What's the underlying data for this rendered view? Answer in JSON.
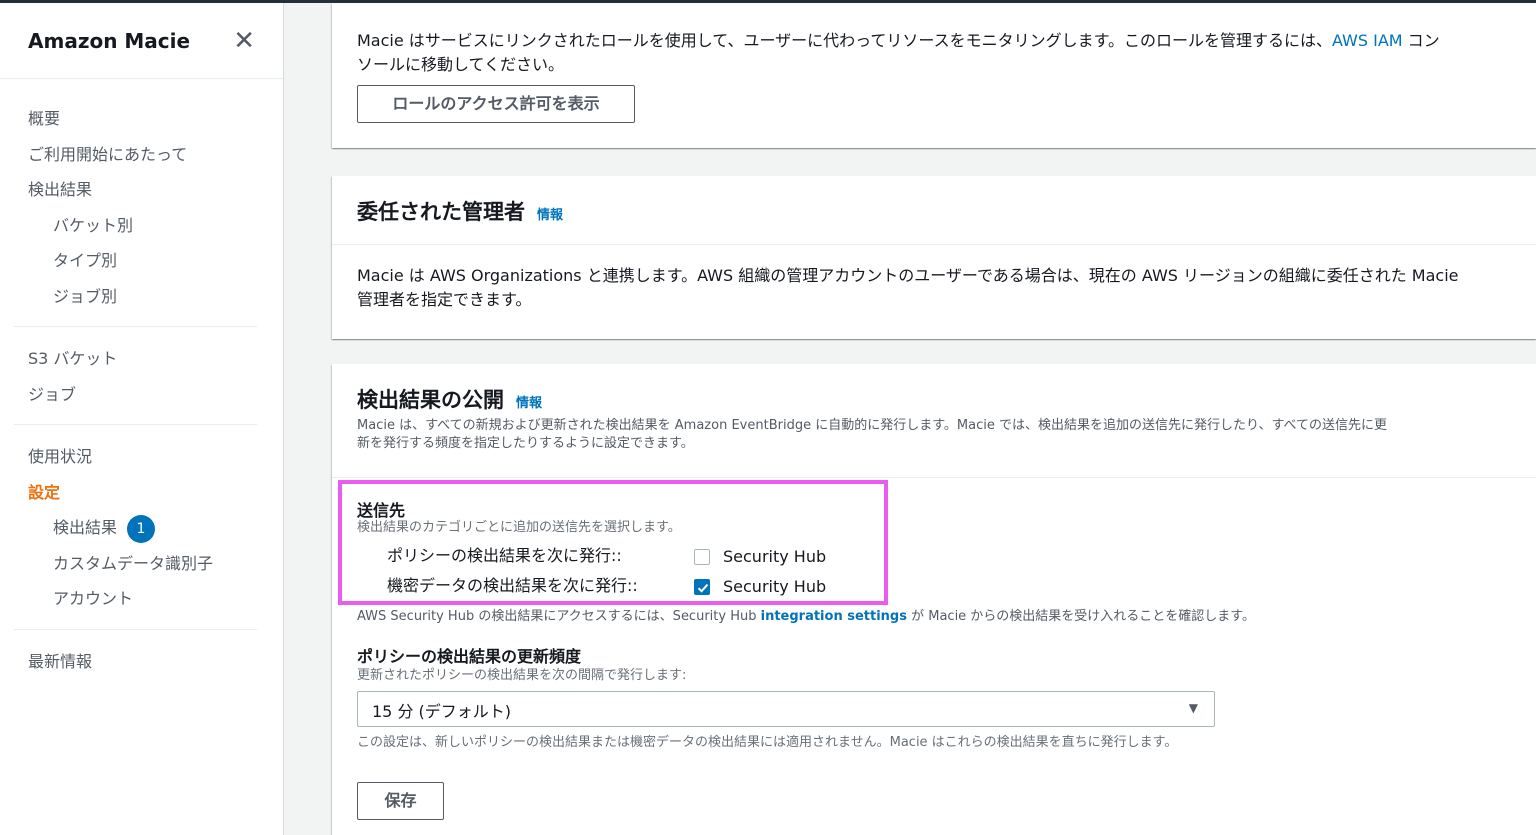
{
  "sidebar": {
    "title": "Amazon Macie",
    "items": [
      {
        "label": "概要"
      },
      {
        "label": "ご利用開始にあたって"
      },
      {
        "label": "検出結果"
      },
      {
        "label": "バケット別"
      },
      {
        "label": "タイプ別"
      },
      {
        "label": "ジョブ別"
      },
      {
        "label": "S3 バケット"
      },
      {
        "label": "ジョブ"
      },
      {
        "label": "使用状況"
      },
      {
        "label": "設定"
      },
      {
        "label": "検出結果",
        "badge": "1"
      },
      {
        "label": "カスタムデータ識別子"
      },
      {
        "label": "アカウント"
      },
      {
        "label": "最新情報"
      }
    ]
  },
  "role_panel": {
    "text_line1_pre": "Macie はサービスにリンクされたロールを使用して、ユーザーに代わってリソースをモニタリングします。このロールを管理するには、",
    "link": "AWS IAM",
    "text_line1_post": " コン",
    "text_line2": "ソールに移動してください。",
    "button": "ロールのアクセス許可を表示"
  },
  "admin_panel": {
    "title": "委任された管理者",
    "info": "情報",
    "text_line1": "Macie は AWS Organizations と連携します。AWS 組織の管理アカウントのユーザーである場合は、現在の AWS リージョンの組織に委任された Macie",
    "text_line2": "管理者を指定できます。"
  },
  "publish_panel": {
    "title": "検出結果の公開",
    "info": "情報",
    "desc_line1": "Macie は、すべての新規および更新された検出結果を Amazon EventBridge に自動的に発行します。Macie では、検出結果を追加の送信先に発行したり、すべての送信先に更",
    "desc_line2": "新を発行する頻度を指定したりするように設定できます。",
    "dest_title": "送信先",
    "dest_desc": "検出結果のカテゴリごとに追加の送信先を選択します。",
    "policy_label": "ポリシーの検出結果を次に発行::",
    "policy_option": "Security Hub",
    "policy_checked": false,
    "sensitive_label": "機密データの検出結果を次に発行::",
    "sensitive_option": "Security Hub",
    "sensitive_checked": true,
    "sh_note_pre": "AWS Security Hub の検出結果にアクセスするには、Security Hub ",
    "sh_note_link": "integration settings",
    "sh_note_post": " が Macie からの検出結果を受け入れることを確認します。",
    "freq_title": "ポリシーの検出結果の更新頻度",
    "freq_desc": "更新されたポリシーの検出結果を次の間隔で発行します:",
    "freq_value": "15 分 (デフォルト)",
    "freq_note": "この設定は、新しいポリシーの検出結果または機密データの検出結果には適用されません。Macie はこれらの検出結果を直ちに発行します。",
    "save": "保存"
  },
  "colors": {
    "accent": "#0073bb",
    "active_nav": "#ec7211",
    "highlight": "#ea5cf0"
  }
}
